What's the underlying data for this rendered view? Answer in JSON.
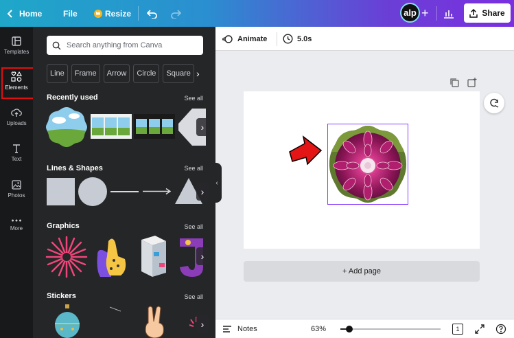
{
  "topbar": {
    "home": "Home",
    "file": "File",
    "resize": "Resize",
    "avatar": "alp",
    "share": "Share",
    "icons": [
      "chevron-left-icon",
      "crown-icon",
      "undo-icon",
      "redo-icon",
      "plus-icon",
      "bar-chart-icon",
      "upload-icon"
    ]
  },
  "rail": {
    "items": [
      {
        "label": "Templates",
        "icon": "templates-icon"
      },
      {
        "label": "Elements",
        "icon": "elements-icon",
        "active": true
      },
      {
        "label": "Uploads",
        "icon": "uploads-icon"
      },
      {
        "label": "Text",
        "icon": "text-icon"
      },
      {
        "label": "Photos",
        "icon": "photos-icon"
      },
      {
        "label": "More",
        "icon": "more-icon"
      }
    ]
  },
  "panel": {
    "search_placeholder": "Search anything from Canva",
    "chips": [
      "Line",
      "Frame",
      "Arrow",
      "Circle",
      "Square"
    ],
    "sections": [
      {
        "title": "Recently used",
        "see_all": "See all"
      },
      {
        "title": "Lines & Shapes",
        "see_all": "See all"
      },
      {
        "title": "Graphics",
        "see_all": "See all"
      },
      {
        "title": "Stickers",
        "see_all": "See all"
      }
    ]
  },
  "editor": {
    "animate": "Animate",
    "duration": "5.0s",
    "add_page": "+ Add page"
  },
  "bottombar": {
    "notes": "Notes",
    "zoom": "63%",
    "zoom_fraction": 0.09,
    "page": "1"
  },
  "colors": {
    "accent": "#8b3dff",
    "panel": "#252627",
    "rail": "#18191b",
    "highlight": "#e01010",
    "arrow": "#e41515"
  }
}
